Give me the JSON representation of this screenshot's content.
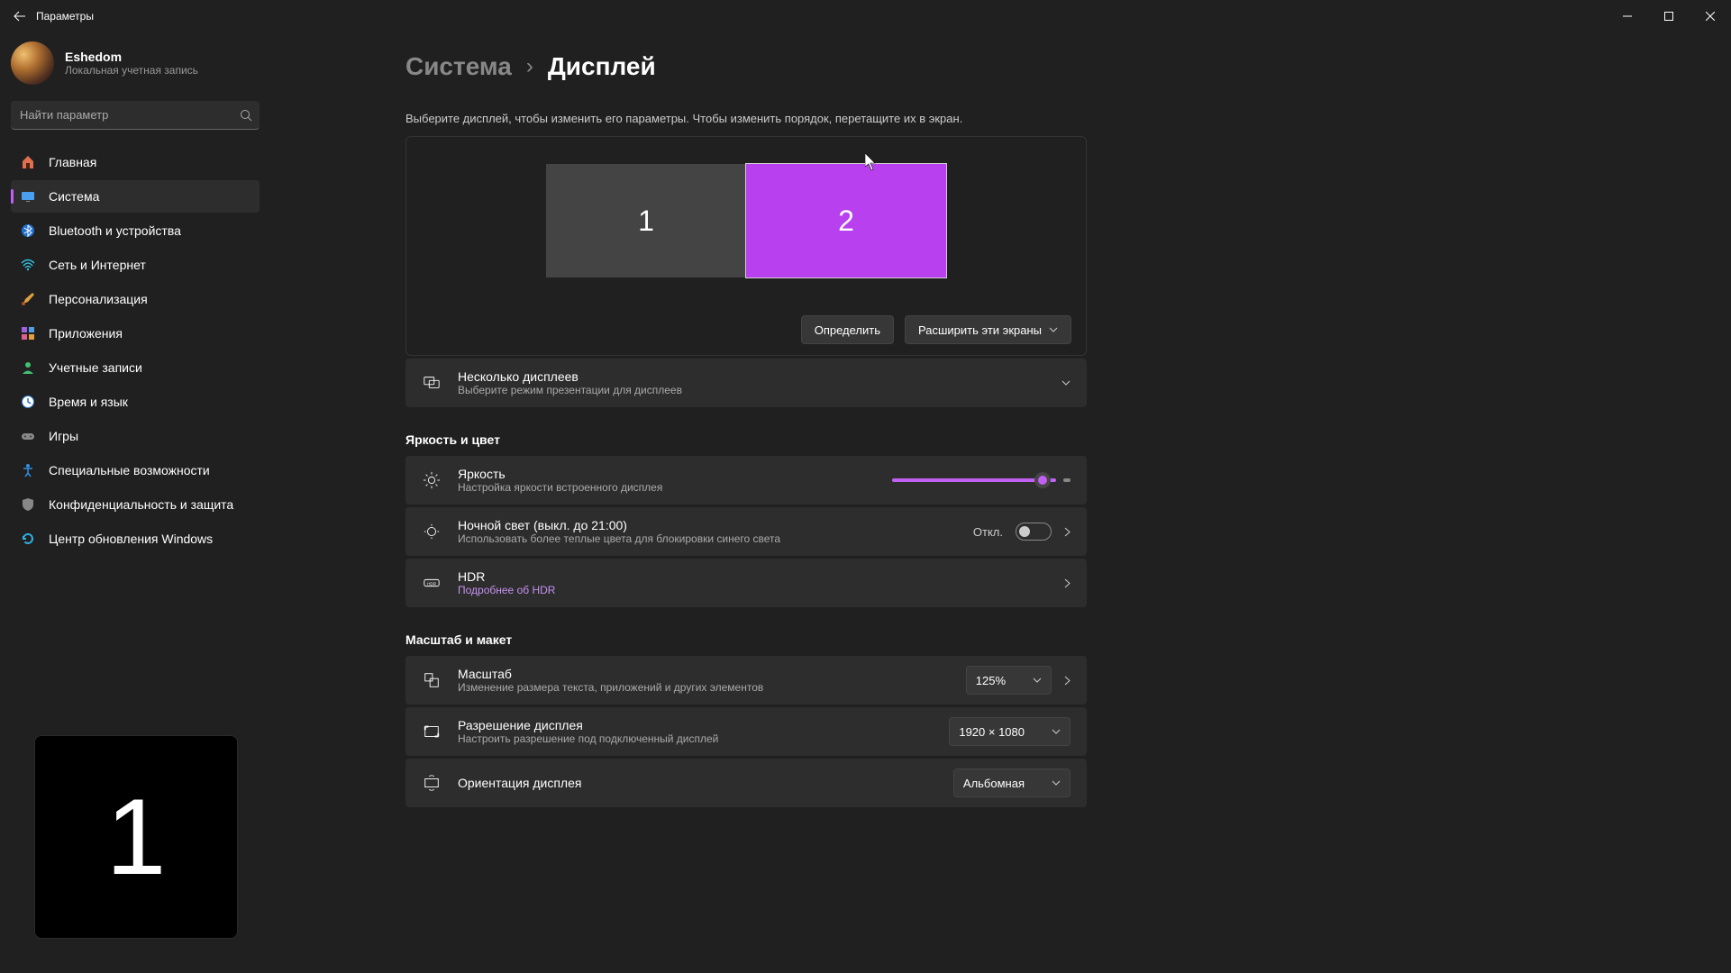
{
  "window": {
    "title": "Параметры"
  },
  "profile": {
    "name": "Eshedom",
    "sub": "Локальная учетная запись"
  },
  "search": {
    "placeholder": "Найти параметр"
  },
  "nav": {
    "items": [
      {
        "label": "Главная"
      },
      {
        "label": "Система"
      },
      {
        "label": "Bluetooth и устройства"
      },
      {
        "label": "Сеть и Интернет"
      },
      {
        "label": "Персонализация"
      },
      {
        "label": "Приложения"
      },
      {
        "label": "Учетные записи"
      },
      {
        "label": "Время и язык"
      },
      {
        "label": "Игры"
      },
      {
        "label": "Специальные возможности"
      },
      {
        "label": "Конфиденциальность и защита"
      },
      {
        "label": "Центр обновления Windows"
      }
    ]
  },
  "breadcrumb": {
    "root": "Система",
    "current": "Дисплей"
  },
  "helper": "Выберите дисплей, чтобы изменить его параметры. Чтобы изменить порядок, перетащите их в экран.",
  "displays": {
    "one": "1",
    "two": "2"
  },
  "arrangement": {
    "identify": "Определить",
    "extend": "Расширить эти экраны"
  },
  "multi": {
    "title": "Несколько дисплеев",
    "sub": "Выберите режим презентации для дисплеев"
  },
  "section_brightness": "Яркость и цвет",
  "brightness": {
    "title": "Яркость",
    "sub": "Настройка яркости встроенного дисплея",
    "value_percent": 95
  },
  "nightlight": {
    "title": "Ночной свет (выкл. до 21:00)",
    "sub": "Использовать более теплые цвета для блокировки синего света",
    "state": "Откл."
  },
  "hdr": {
    "title": "HDR",
    "link": "Подробнее об HDR"
  },
  "section_scale": "Масштаб и макет",
  "scale": {
    "title": "Масштаб",
    "sub": "Изменение размера текста, приложений и других элементов",
    "value": "125%"
  },
  "resolution": {
    "title": "Разрешение дисплея",
    "sub": "Настроить разрешение под подключенный дисплей",
    "value": "1920 × 1080"
  },
  "orientation": {
    "title": "Ориентация дисплея",
    "value": "Альбомная"
  },
  "identify_overlay": "1"
}
